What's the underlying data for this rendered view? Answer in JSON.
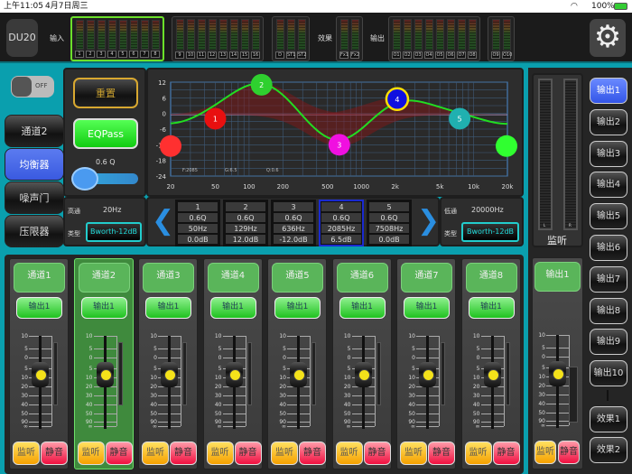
{
  "status": {
    "time": "上午11:05",
    "date": "4月7日周三",
    "battery": "100%"
  },
  "topbar": {
    "device": "DU20",
    "input_label": "输入",
    "effects_label": "效果",
    "output_label": "输出",
    "meter_groups": [
      {
        "labels": [
          "1",
          "2",
          "3",
          "4",
          "5",
          "6",
          "7",
          "8"
        ],
        "selected": true
      },
      {
        "labels": [
          "9",
          "10",
          "11",
          "12",
          "13",
          "14",
          "15",
          "16"
        ],
        "selected": false
      },
      {
        "labels": [
          "D",
          "ST1",
          "ST2"
        ],
        "selected": false
      },
      {
        "labels": [
          "Fx1",
          "Fx2"
        ],
        "selected": false
      },
      {
        "labels": [
          "O1",
          "O2",
          "O3",
          "O4",
          "O5",
          "O6",
          "O7",
          "O8"
        ],
        "selected": false
      },
      {
        "labels": [
          "O9",
          "O10"
        ],
        "selected": false
      }
    ]
  },
  "toggle": {
    "label": "OFF",
    "on": false
  },
  "tabs": [
    {
      "label": "通道2",
      "active": false
    },
    {
      "label": "均衡器",
      "active": true
    },
    {
      "label": "噪声门",
      "active": false
    },
    {
      "label": "压限器",
      "active": false
    }
  ],
  "eq_controls": {
    "reset": "重置",
    "eqpass": "EQPass",
    "q_label": "0.6 Q",
    "q_slider_value": 0.1
  },
  "highpass": {
    "label": "高通",
    "freq": "20Hz",
    "type_label": "类型",
    "type": "Bworth-12dB"
  },
  "lowpass": {
    "label": "低通",
    "freq": "20000Hz",
    "type_label": "类型",
    "type": "Bworth-12dB"
  },
  "chart_data": {
    "type": "line",
    "title": "",
    "xscale": "log",
    "xlim": [
      20,
      20000
    ],
    "ylim": [
      -24,
      12
    ],
    "x_ticks": [
      "20",
      "50",
      "100",
      "200",
      "500",
      "1000",
      "2k",
      "5k",
      "10k",
      "20k"
    ],
    "x_tick_values": [
      20,
      50,
      100,
      200,
      500,
      1000,
      2000,
      5000,
      10000,
      20000
    ],
    "y_ticks": [
      "12",
      "6",
      "0",
      "-6",
      "-12",
      "-18",
      "-24"
    ],
    "readout": {
      "f": "F:2085",
      "g": "G:6.5",
      "q": "Q:0.6"
    },
    "bands": [
      {
        "id": "1",
        "q": "0.6Q",
        "freq": 50,
        "freq_label": "50Hz",
        "gain": 0,
        "gain_label": "0.0dB",
        "color": "#e81010"
      },
      {
        "id": "2",
        "q": "0.6Q",
        "freq": 129,
        "freq_label": "129Hz",
        "gain": 12,
        "gain_label": "12.0dB",
        "color": "#2fd02f"
      },
      {
        "id": "3",
        "q": "0.6Q",
        "freq": 636,
        "freq_label": "636Hz",
        "gain": -12,
        "gain_label": "-12.0dB",
        "color": "#f010e0"
      },
      {
        "id": "4",
        "q": "0.6Q",
        "freq": 2085,
        "freq_label": "2085Hz",
        "gain": 6.5,
        "gain_label": "6.5dB",
        "color": "#1010e0",
        "selected": true
      },
      {
        "id": "5",
        "q": "0.6Q",
        "freq": 7508,
        "freq_label": "7508Hz",
        "gain": 0,
        "gain_label": "0.0dB",
        "color": "#20b0b0"
      }
    ],
    "highpass_node": {
      "freq": 20,
      "color": "#ff3030"
    },
    "lowpass_node": {
      "freq": 20000,
      "color": "#30ff30"
    }
  },
  "channels": [
    {
      "name": "通道1",
      "output": "输出1",
      "monitor": "监听",
      "mute": "静音",
      "selected": false
    },
    {
      "name": "通道2",
      "output": "输出1",
      "monitor": "监听",
      "mute": "静音",
      "selected": true
    },
    {
      "name": "通道3",
      "output": "输出1",
      "monitor": "监听",
      "mute": "静音",
      "selected": false
    },
    {
      "name": "通道4",
      "output": "输出1",
      "monitor": "监听",
      "mute": "静音",
      "selected": false
    },
    {
      "name": "通道5",
      "output": "输出1",
      "monitor": "监听",
      "mute": "静音",
      "selected": false
    },
    {
      "name": "通道6",
      "output": "输出1",
      "monitor": "监听",
      "mute": "静音",
      "selected": false
    },
    {
      "name": "通道7",
      "output": "输出1",
      "monitor": "监听",
      "mute": "静音",
      "selected": false
    },
    {
      "name": "通道8",
      "output": "输出1",
      "monitor": "监听",
      "mute": "静音",
      "selected": false
    }
  ],
  "fader_scale": [
    "10",
    "5",
    "0",
    "5",
    "10",
    "20",
    "30",
    "40",
    "50",
    "90",
    "∞"
  ],
  "monitor_panel": {
    "label": "监听",
    "left": "L",
    "right": "R"
  },
  "output_strip": {
    "name": "输出1",
    "monitor": "监听",
    "mute": "静音"
  },
  "output_buttons": [
    {
      "label": "输出1",
      "active": true
    },
    {
      "label": "输出2"
    },
    {
      "label": "输出3"
    },
    {
      "label": "输出4"
    },
    {
      "label": "输出5"
    },
    {
      "label": "输出6"
    },
    {
      "label": "输出7"
    },
    {
      "label": "输出8"
    },
    {
      "label": "输出9"
    },
    {
      "label": "输出10"
    },
    {
      "label": "效果1"
    },
    {
      "label": "效果2"
    }
  ]
}
